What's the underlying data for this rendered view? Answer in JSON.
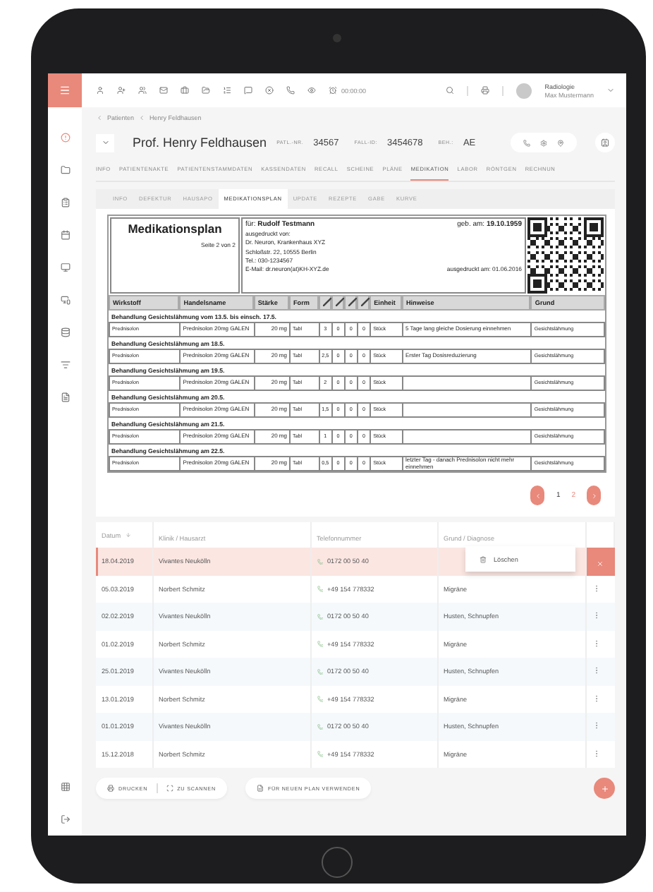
{
  "toolbar": {
    "time": "00:00:00",
    "user": {
      "department": "Radiologie",
      "name": "Max Mustermann"
    }
  },
  "breadcrumb": [
    "Patienten",
    "Henry Feldhausen"
  ],
  "patient": {
    "name": "Prof. Henry Feldhausen",
    "fields": [
      {
        "label": "PATL.-NR.",
        "value": "34567"
      },
      {
        "label": "FALL-ID:",
        "value": "3454678"
      },
      {
        "label": "BEH.:",
        "value": "AE"
      }
    ]
  },
  "tabs": [
    {
      "label": "INFO",
      "selected": false
    },
    {
      "label": "PATIENTENAKTE",
      "selected": false
    },
    {
      "label": "PATIENTENSTAMMDATEN",
      "selected": false
    },
    {
      "label": "KASSENDATEN",
      "selected": false
    },
    {
      "label": "RECALL",
      "selected": false
    },
    {
      "label": "SCHEINE",
      "selected": false
    },
    {
      "label": "PLÄNE",
      "selected": false
    },
    {
      "label": "MEDIKATION",
      "selected": true
    },
    {
      "label": "LABOR",
      "selected": false
    },
    {
      "label": "RÖNTGEN",
      "selected": false
    },
    {
      "label": "RECHNUN",
      "selected": false
    }
  ],
  "subtabs": [
    {
      "label": "INFO",
      "selected": false
    },
    {
      "label": "DEFEKTUR",
      "selected": false
    },
    {
      "label": "HAUSAPO",
      "selected": false
    },
    {
      "label": "MEDIKATIONSPLAN",
      "selected": true
    },
    {
      "label": "UPDATE",
      "selected": false
    },
    {
      "label": "REZEPTE",
      "selected": false
    },
    {
      "label": "GABE",
      "selected": false
    },
    {
      "label": "KURVE",
      "selected": false
    }
  ],
  "plan": {
    "title": "Medikationsplan",
    "page": "Seite 2 von 2",
    "for_label": "für:",
    "patient": "Rudolf Testmann",
    "dob_label": "geb. am:",
    "dob": "19.10.1959",
    "printed_by": [
      "ausgedruckt von:",
      "Dr. Neuron, Krankenhaus XYZ",
      "Schloßstr. 22, 10555 Berlin",
      "Tel.: 030-1234567",
      "E-Mail: dr.neuron(at)KH-XYZ.de"
    ],
    "printed_on": "ausgedruckt am: 01.06.2016",
    "columns": [
      "Wirkstoff",
      "Handelsname",
      "Stärke",
      "Form",
      "Einheit",
      "Hinweise",
      "Grund"
    ],
    "sections": [
      {
        "heading": "Behandlung Gesichtslähmung vom 13.5. bis einsch. 17.5.",
        "row": {
          "substance": "Prednisolon",
          "brand": "Prednisolon 20mg GALEN",
          "strength": "20 mg",
          "form": "Tabl",
          "doses": [
            "3",
            "0",
            "0",
            "0"
          ],
          "unit": "Stück",
          "note": "5 Tage lang gleiche Dosierung einnehmen",
          "reason": "Gesichtslähmung"
        }
      },
      {
        "heading": "Behandlung Gesichtslähmung am 18.5.",
        "row": {
          "substance": "Prednisolon",
          "brand": "Prednisolon 20mg GALEN",
          "strength": "20 mg",
          "form": "Tabl",
          "doses": [
            "2,5",
            "0",
            "0",
            "0"
          ],
          "unit": "Stück",
          "note": "Erster Tag Dosisreduzierung",
          "reason": "Gesichtslähmung"
        }
      },
      {
        "heading": "Behandlung Gesichtslähmung am 19.5.",
        "row": {
          "substance": "Prednisolon",
          "brand": "Prednisolon 20mg GALEN",
          "strength": "20 mg",
          "form": "Tabl",
          "doses": [
            "2",
            "0",
            "0",
            "0"
          ],
          "unit": "Stück",
          "reason": "Gesichtslähmung"
        }
      },
      {
        "heading": "Behandlung Gesichtslähmung am 20.5.",
        "row": {
          "substance": "Prednisolon",
          "brand": "Prednisolon 20mg GALEN",
          "strength": "20 mg",
          "form": "Tabl",
          "doses": [
            "1,5",
            "0",
            "0",
            "0"
          ],
          "unit": "Stück",
          "reason": "Gesichtslähmung"
        }
      },
      {
        "heading": "Behandlung Gesichtslähmung am 21.5.",
        "row": {
          "substance": "Prednisolon",
          "brand": "Prednisolon 20mg GALEN",
          "strength": "20 mg",
          "form": "Tabl",
          "doses": [
            "1",
            "0",
            "0",
            "0"
          ],
          "unit": "Stück",
          "reason": "Gesichtslähmung"
        }
      },
      {
        "heading": "Behandlung Gesichtslähmung am 22.5.",
        "row": {
          "substance": "Prednisolon",
          "brand": "Prednisolon 20mg GALEN",
          "strength": "20 mg",
          "form": "Tabl",
          "doses": [
            "0,5",
            "0",
            "0",
            "0"
          ],
          "unit": "Stück",
          "note": "letzter Tag - danach Prednisolon nicht mehr einnehmen",
          "reason": "Gesichtslähmung"
        }
      }
    ]
  },
  "pages": [
    {
      "label": "1",
      "selected": true
    },
    {
      "label": "2",
      "selected": false
    }
  ],
  "list": {
    "columns": [
      "Datum",
      "Klinik / Hausarzt",
      "Telefonnummer",
      "Grund / Diagnose"
    ],
    "rows": [
      {
        "date": "18.04.2019",
        "clinic": "Vivantes Neukölln",
        "phone": "0172 00 50 40",
        "selected": true
      },
      {
        "date": "05.03.2019",
        "clinic": "Norbert Schmitz",
        "phone": "+49 154 778332",
        "reason": "Migräne",
        "selected": false
      },
      {
        "date": "02.02.2019",
        "clinic": "Vivantes Neukölln",
        "phone": "0172 00 50 40",
        "reason": "Husten, Schnupfen",
        "selected": false
      },
      {
        "date": "01.02.2019",
        "clinic": "Norbert Schmitz",
        "phone": "+49 154 778332",
        "reason": "Migräne",
        "selected": false
      },
      {
        "date": "25.01.2019",
        "clinic": "Vivantes Neukölln",
        "phone": "0172 00 50 40",
        "reason": "Husten, Schnupfen",
        "selected": false
      },
      {
        "date": "13.01.2019",
        "clinic": "Norbert Schmitz",
        "phone": "+49 154 778332",
        "reason": "Migräne",
        "selected": false
      },
      {
        "date": "01.01.2019",
        "clinic": "Vivantes Neukölln",
        "phone": "0172 00 50 40",
        "reason": "Husten, Schnupfen",
        "selected": false
      },
      {
        "date": "15.12.2018",
        "clinic": "Norbert Schmitz",
        "phone": "+49 154 778332",
        "reason": "Migräne",
        "selected": false
      }
    ],
    "menu": {
      "item": "Löschen"
    }
  },
  "buttons": {
    "print": "DRUCKEN",
    "scan": "ZU SCANNEN",
    "reuse": "FÜR NEUEN PLAN VERWENDEN"
  }
}
